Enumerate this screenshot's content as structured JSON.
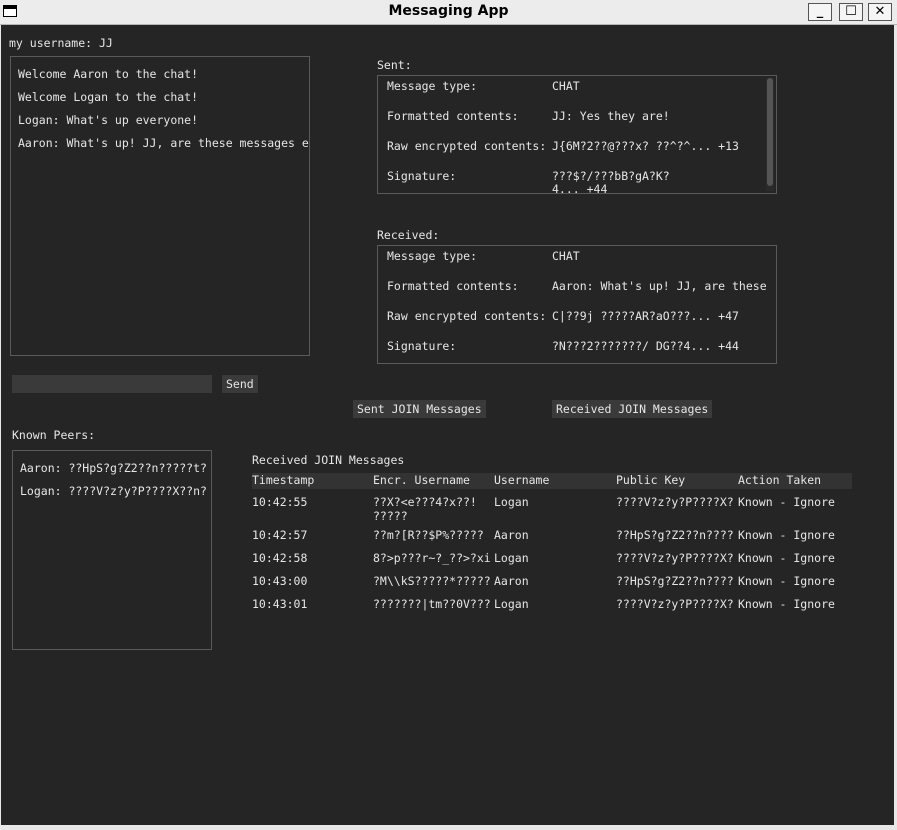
{
  "window": {
    "title": "Messaging App",
    "minimize": "_",
    "maximize": "☐",
    "close": "✕"
  },
  "username_label": "my username: JJ",
  "chat": [
    "Welcome Aaron to the chat!",
    "Welcome Logan to the chat!",
    "Logan: What's up everyone!",
    "Aaron: What's up! JJ, are these messages e"
  ],
  "compose": {
    "value": "",
    "send_label": "Send"
  },
  "sent": {
    "heading": "Sent:",
    "labels": [
      "Message type:",
      "Formatted contents:",
      "Raw encrypted contents:",
      "Signature:"
    ],
    "values": [
      "CHAT",
      "JJ: Yes they are!",
      "J{6M?2??@???x?    ??^?^... +13",
      "???$?/???bB?gA?K?"
    ],
    "signature_cont": "4... +44"
  },
  "received": {
    "heading": "Received:",
    "labels": [
      "Message type:",
      "Formatted contents:",
      "Raw encrypted contents:",
      "Signature:"
    ],
    "values": [
      "CHAT",
      "Aaron: What's up! JJ, are these",
      "C|??9j ?????AR?aO???... +47",
      "?N???2???????/    DG??4... +44"
    ]
  },
  "buttons": {
    "sent_join": "Sent JOIN Messages",
    "received_join": "Received JOIN Messages"
  },
  "known_peers": {
    "heading": "Known Peers:",
    "items": [
      "Aaron: ??HpS?g?Z2??n?????t?",
      "Logan: ????V?z?y?P????X??n?"
    ]
  },
  "join_table": {
    "title": "Received JOIN Messages",
    "headers": [
      "Timestamp",
      "Encr. Username",
      "Username",
      "Public Key",
      "Action Taken"
    ],
    "rows": [
      [
        "10:42:55",
        "??X?<e???4?x??!\n?????",
        "Logan",
        "????V?z?y?P????X?",
        "Known - Ignore"
      ],
      [
        "10:42:57",
        "??m?[R??$P%?????",
        "Aaron",
        "??HpS?g?Z2??n????",
        "Known - Ignore"
      ],
      [
        "10:42:58",
        "8?>p???r~?_??>?xi",
        "Logan",
        "????V?z?y?P????X?",
        "Known - Ignore"
      ],
      [
        "10:43:00",
        "?M\\\\kS?????*?????",
        "Aaron",
        "??HpS?g?Z2??n????",
        "Known - Ignore"
      ],
      [
        "10:43:01",
        "???????|tm??0V???",
        "Logan",
        "????V?z?y?P????X?",
        "Known - Ignore"
      ]
    ]
  }
}
